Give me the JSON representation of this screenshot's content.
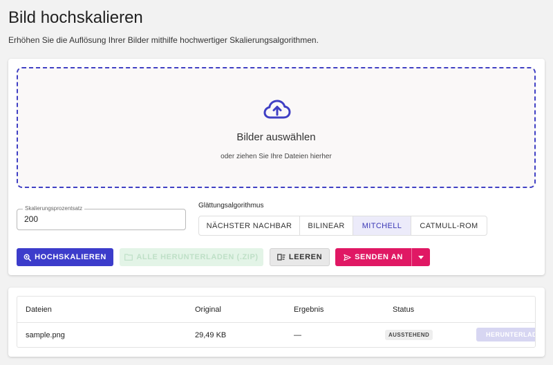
{
  "page": {
    "title": "Bild hochskalieren",
    "subtitle": "Erhöhen Sie die Auflösung Ihrer Bilder mithilfe hochwertiger Skalierungsalgorithmen."
  },
  "dropzone": {
    "title": "Bilder auswählen",
    "subtitle": "oder ziehen Sie Ihre Dateien hierher",
    "icon": "cloud-upload-icon"
  },
  "scale_field": {
    "label": "Skalierungsprozentsatz",
    "value": "200"
  },
  "algorithm": {
    "label": "Glättungsalgorithmus",
    "options": [
      "NÄCHSTER NACHBAR",
      "BILINEAR",
      "MITCHELL",
      "CATMULL-ROM"
    ],
    "selected": "MITCHELL"
  },
  "actions": {
    "upscale": "HOCHSKALIEREN",
    "download_all": "ALLE HERUNTERLADEN (.ZIP)",
    "clear": "LEEREN",
    "send": "SENDEN AN"
  },
  "table": {
    "headers": [
      "Dateien",
      "Original",
      "Ergebnis",
      "Status"
    ],
    "rows": [
      {
        "file": "sample.png",
        "original": "29,49 KB",
        "result": "—",
        "status": "AUSSTEHEND",
        "action": "HERUNTERLADEN"
      }
    ]
  },
  "colors": {
    "primary": "#3c3ccb",
    "accent": "#e01864",
    "dropzone_border": "#3f3fc4"
  }
}
